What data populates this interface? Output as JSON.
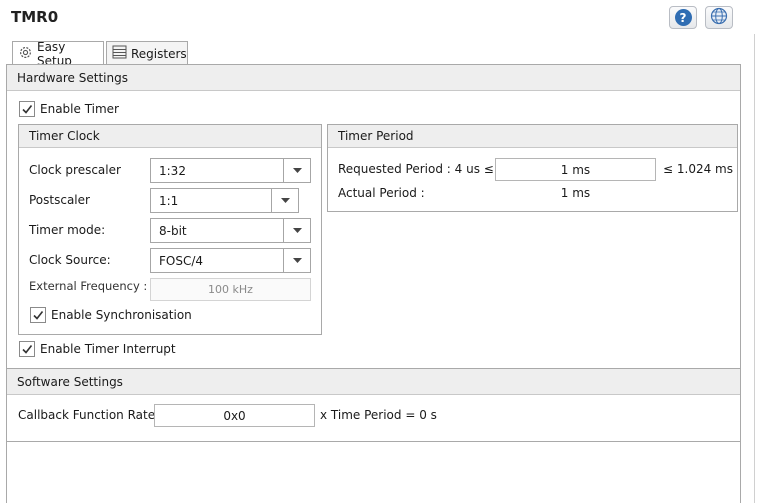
{
  "header": {
    "title": "TMR0",
    "help_icon": "question-mark-icon",
    "web_icon": "globe-icon",
    "help_glyph": "?"
  },
  "tabs": [
    {
      "label": "Easy Setup",
      "icon": "gear-icon",
      "active": true
    },
    {
      "label": "Registers",
      "icon": "list-icon",
      "active": false
    }
  ],
  "hardware": {
    "title": "Hardware Settings",
    "enable_timer": {
      "label": "Enable Timer",
      "checked": true
    },
    "timer_clock": {
      "title": "Timer Clock",
      "clock_prescaler": {
        "label": "Clock prescaler",
        "value": "1:32"
      },
      "postscaler": {
        "label": "Postscaler",
        "value": "1:1"
      },
      "timer_mode": {
        "label": "Timer mode:",
        "value": "8-bit"
      },
      "clock_source": {
        "label": "Clock Source:",
        "value": "FOSC/4"
      },
      "external_frequency": {
        "label": "External Frequency :",
        "value": "100 kHz"
      },
      "enable_sync": {
        "label": "Enable Synchronisation",
        "checked": true
      }
    },
    "timer_period": {
      "title": "Timer Period",
      "requested_label": "Requested Period : 4 us  ≤",
      "requested_value": "1 ms",
      "requested_max": "≤  1.024 ms",
      "actual_label": "Actual Period :",
      "actual_value": "1 ms"
    },
    "enable_interrupt": {
      "label": "Enable Timer Interrupt",
      "checked": true
    }
  },
  "software": {
    "title": "Software Settings",
    "callback_label": "Callback Function Rate",
    "callback_value": "0x0",
    "callback_suffix": "x Time Period = 0 s"
  },
  "colors": {
    "accent": "#2f6db3"
  }
}
